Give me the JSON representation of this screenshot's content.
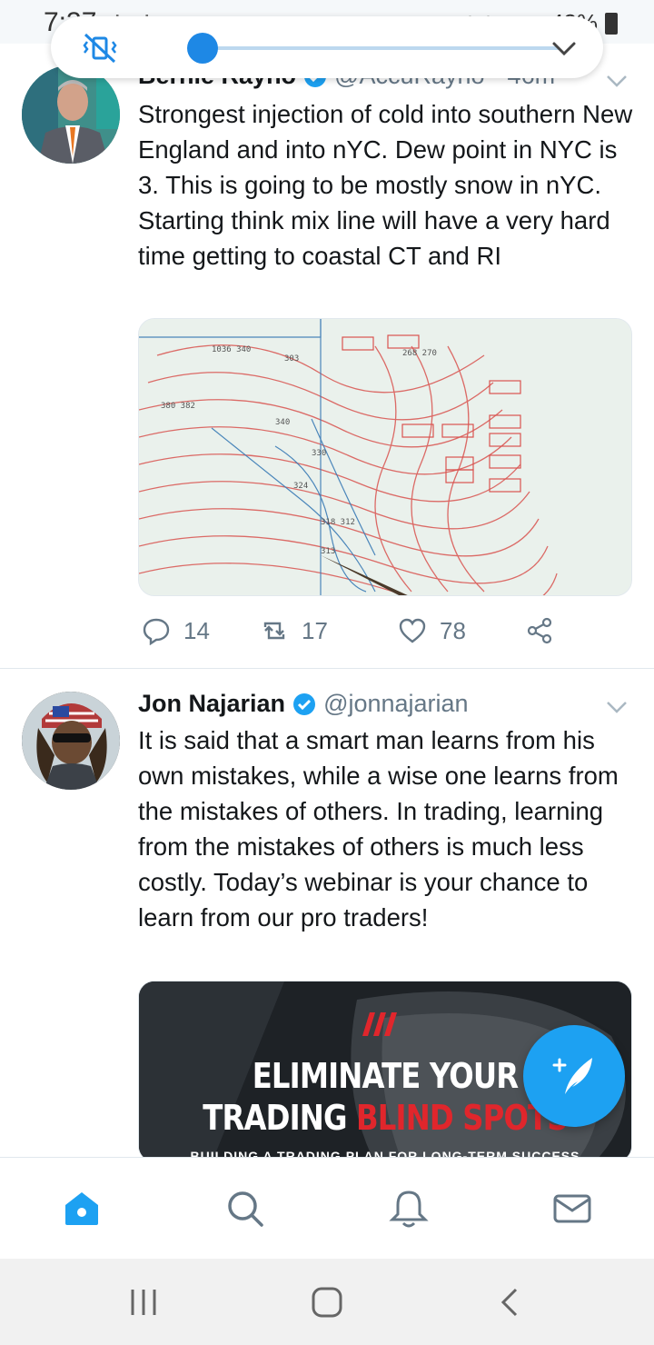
{
  "status_bar": {
    "time": "7:37",
    "battery": "42%"
  },
  "volume_overlay": {
    "mute_icon": "vibrate-mute-icon",
    "level": 0.0,
    "expand_icon": "chevron-down-icon"
  },
  "tweets": [
    {
      "display_name": "Bernie Rayno",
      "verified": true,
      "handle": "@AccuRayno",
      "time": "46m",
      "text": "Strongest injection of cold into southern New England and into nYC. Dew point in NYC is 3. This is going to be mostly snow in nYC. Starting think mix line will have a very hard time getting to coastal CT and RI",
      "media_type": "weather-map-photo",
      "replies": "14",
      "retweets": "17",
      "likes": "78"
    },
    {
      "display_name": "Jon Najarian",
      "verified": true,
      "handle": "@jonnajarian",
      "text": "It is said that a smart man learns from his own mistakes, while a wise one learns from the mistakes of others. In trading, learning from the mistakes of others is much less costly. Today’s webinar is your chance to learn from our pro traders!",
      "media": {
        "title_line1": "ELIMINATE YOUR",
        "title_line2_white": "TRADING ",
        "title_line2_red": "BLIND SPOTS",
        "subtitle": "BUILDING A TRADING PLAN FOR LONG-TERM SUCCESS"
      }
    }
  ],
  "fab_icon": "compose-tweet-icon",
  "tabbar": [
    "home-icon",
    "search-icon",
    "notifications-icon",
    "messages-icon"
  ],
  "navbar": [
    "recent-apps-icon",
    "home-button-icon",
    "back-icon"
  ],
  "colors": {
    "accent": "#1da1f2",
    "secondary_text": "#657786",
    "promo_red": "#e0262c"
  }
}
